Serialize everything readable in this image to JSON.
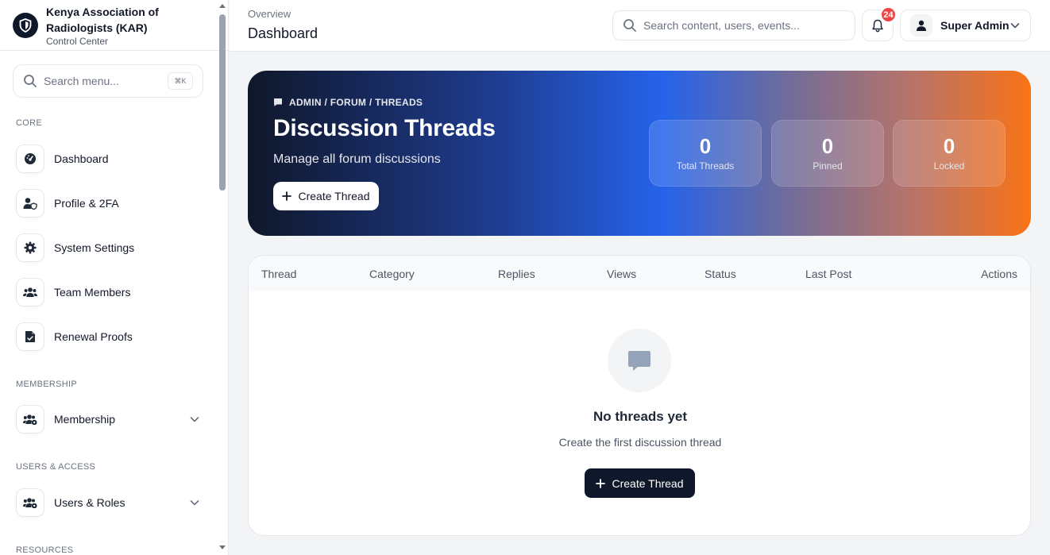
{
  "brand": {
    "title": "Kenya Association of Radiologists (KAR)",
    "subtitle": "Control Center"
  },
  "sidebar": {
    "search_placeholder": "Search menu...",
    "shortcut": "⌘K",
    "sections": {
      "core": "CORE",
      "membership": "MEMBERSHIP",
      "users_access": "USERS & ACCESS",
      "resources": "RESOURCES"
    },
    "items": [
      {
        "label": "Dashboard",
        "icon": "gauge-icon"
      },
      {
        "label": "Profile & 2FA",
        "icon": "user-shield-icon"
      },
      {
        "label": "System Settings",
        "icon": "gear-icon"
      },
      {
        "label": "Team Members",
        "icon": "users-icon"
      },
      {
        "label": "Renewal Proofs",
        "icon": "file-check-icon"
      },
      {
        "label": "Membership",
        "icon": "users-gear-icon"
      },
      {
        "label": "Users & Roles",
        "icon": "users-gear-icon"
      }
    ]
  },
  "topbar": {
    "breadcrumb": "Overview",
    "title": "Dashboard",
    "search_placeholder": "Search content, users, events...",
    "notifications": "24",
    "user": "Super Admin"
  },
  "hero": {
    "breadcrumb": "ADMIN / FORUM / THREADS",
    "title": "Discussion Threads",
    "subtitle": "Manage all forum discussions",
    "button": "Create Thread",
    "stats": [
      {
        "value": "0",
        "label": "Total Threads"
      },
      {
        "value": "0",
        "label": "Pinned"
      },
      {
        "value": "0",
        "label": "Locked"
      }
    ]
  },
  "table": {
    "columns": [
      "Thread",
      "Category",
      "Replies",
      "Views",
      "Status",
      "Last Post",
      "Actions"
    ],
    "empty_title": "No threads yet",
    "empty_subtitle": "Create the first discussion thread",
    "empty_button": "Create Thread"
  },
  "colors": {
    "primary_dark": "#0f172a",
    "accent_blue": "#2563eb",
    "accent_orange": "#f97316",
    "badge_red": "#ef4444"
  }
}
